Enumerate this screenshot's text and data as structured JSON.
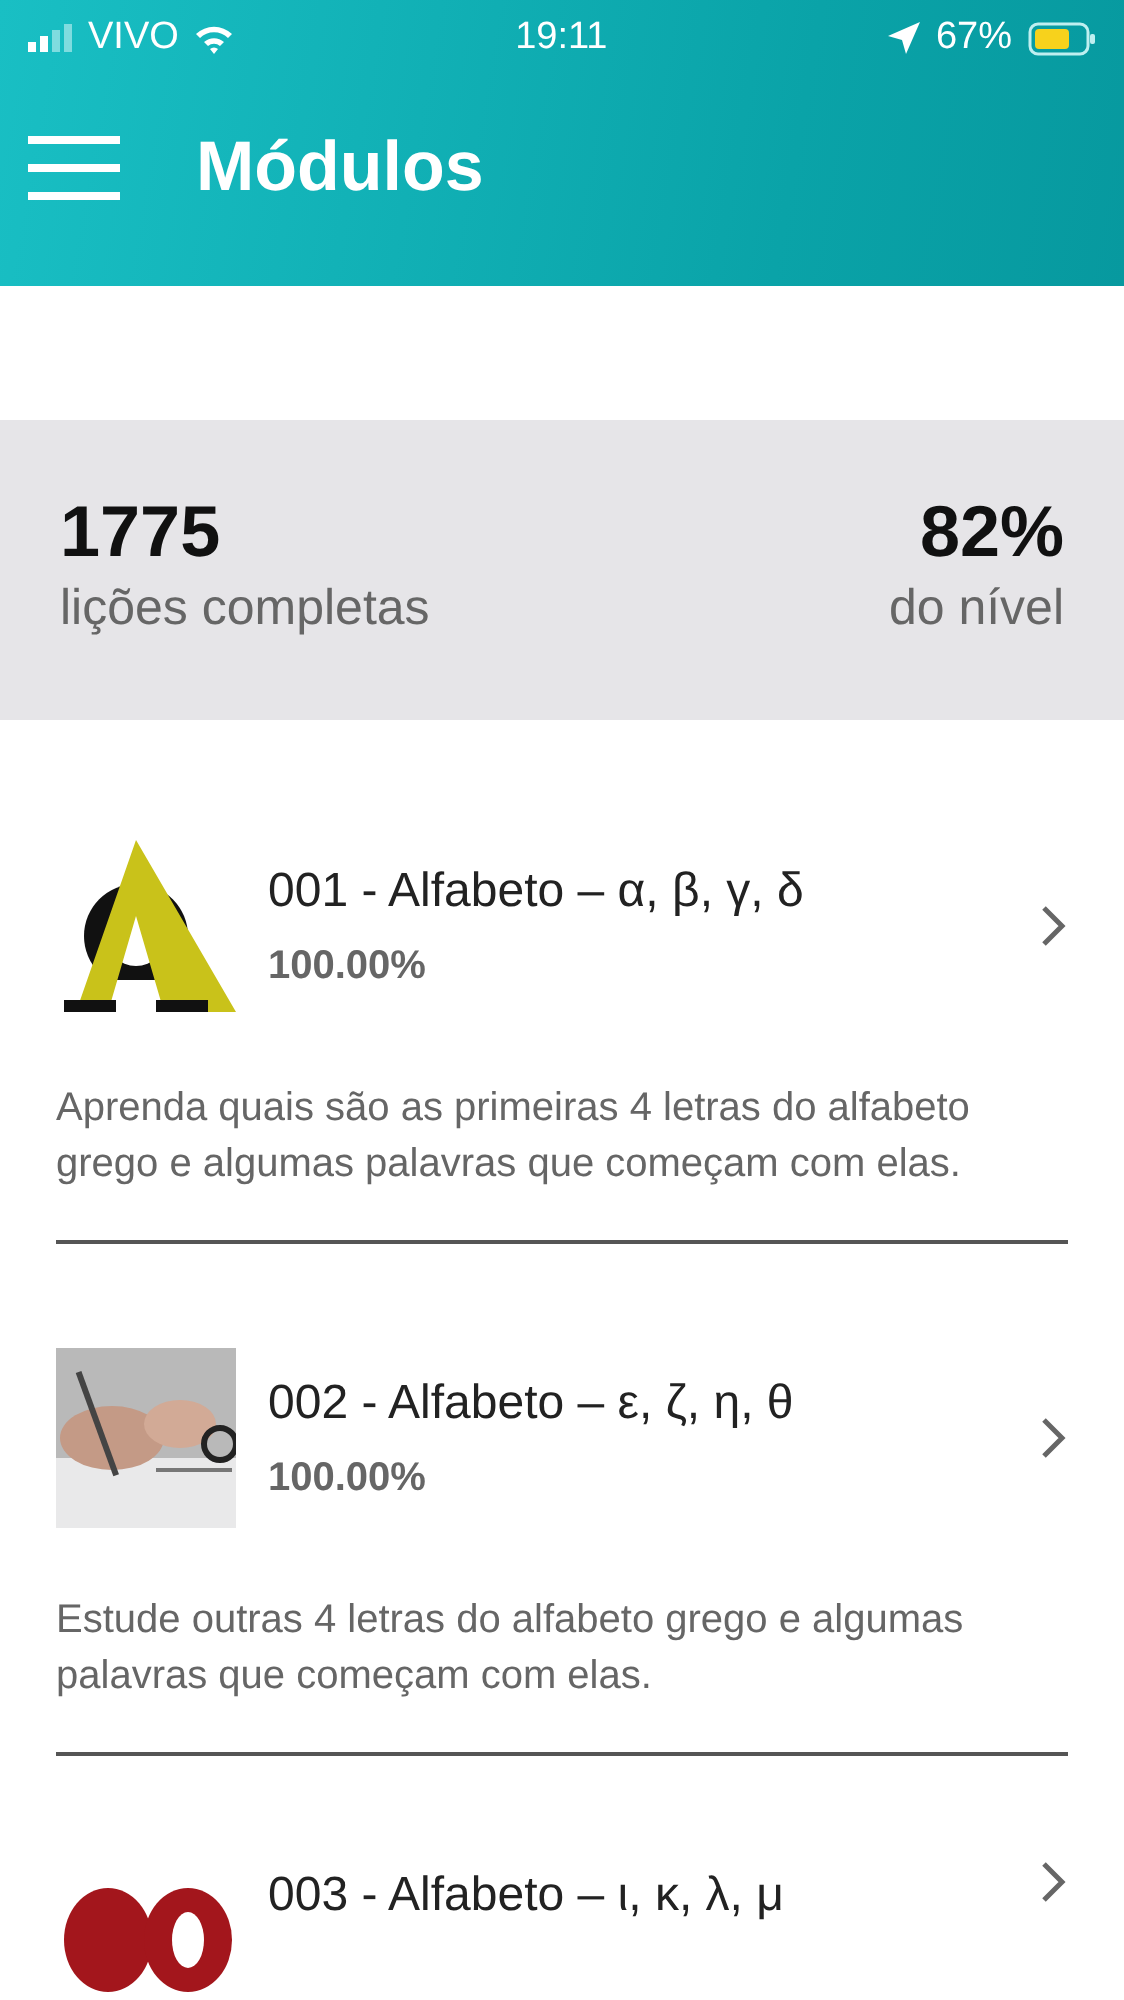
{
  "status_bar": {
    "carrier": "VIVO",
    "time": "19:11",
    "battery": "67%"
  },
  "header": {
    "title": "Módulos"
  },
  "stats": [
    {
      "value": "1775",
      "label": "lições completas"
    },
    {
      "value": "82%",
      "label": "do nível"
    }
  ],
  "modules": [
    {
      "title": "001 - Alfabeto – α, β, γ, δ",
      "percent": "100.00%",
      "description": "Aprenda quais são as primeiras 4 letras do alfabeto grego e algumas palavras que começam com elas.",
      "kind": "picture"
    },
    {
      "title": "002 - Alfabeto – ε, ζ, η, θ",
      "percent": "100.00%",
      "description": "Estude outras 4 letras do alfabeto grego e algumas palavras que começam com elas.",
      "kind": "picture"
    },
    {
      "title": "003 - Alfabeto – ι, κ, λ, μ",
      "kind": "picture"
    }
  ]
}
